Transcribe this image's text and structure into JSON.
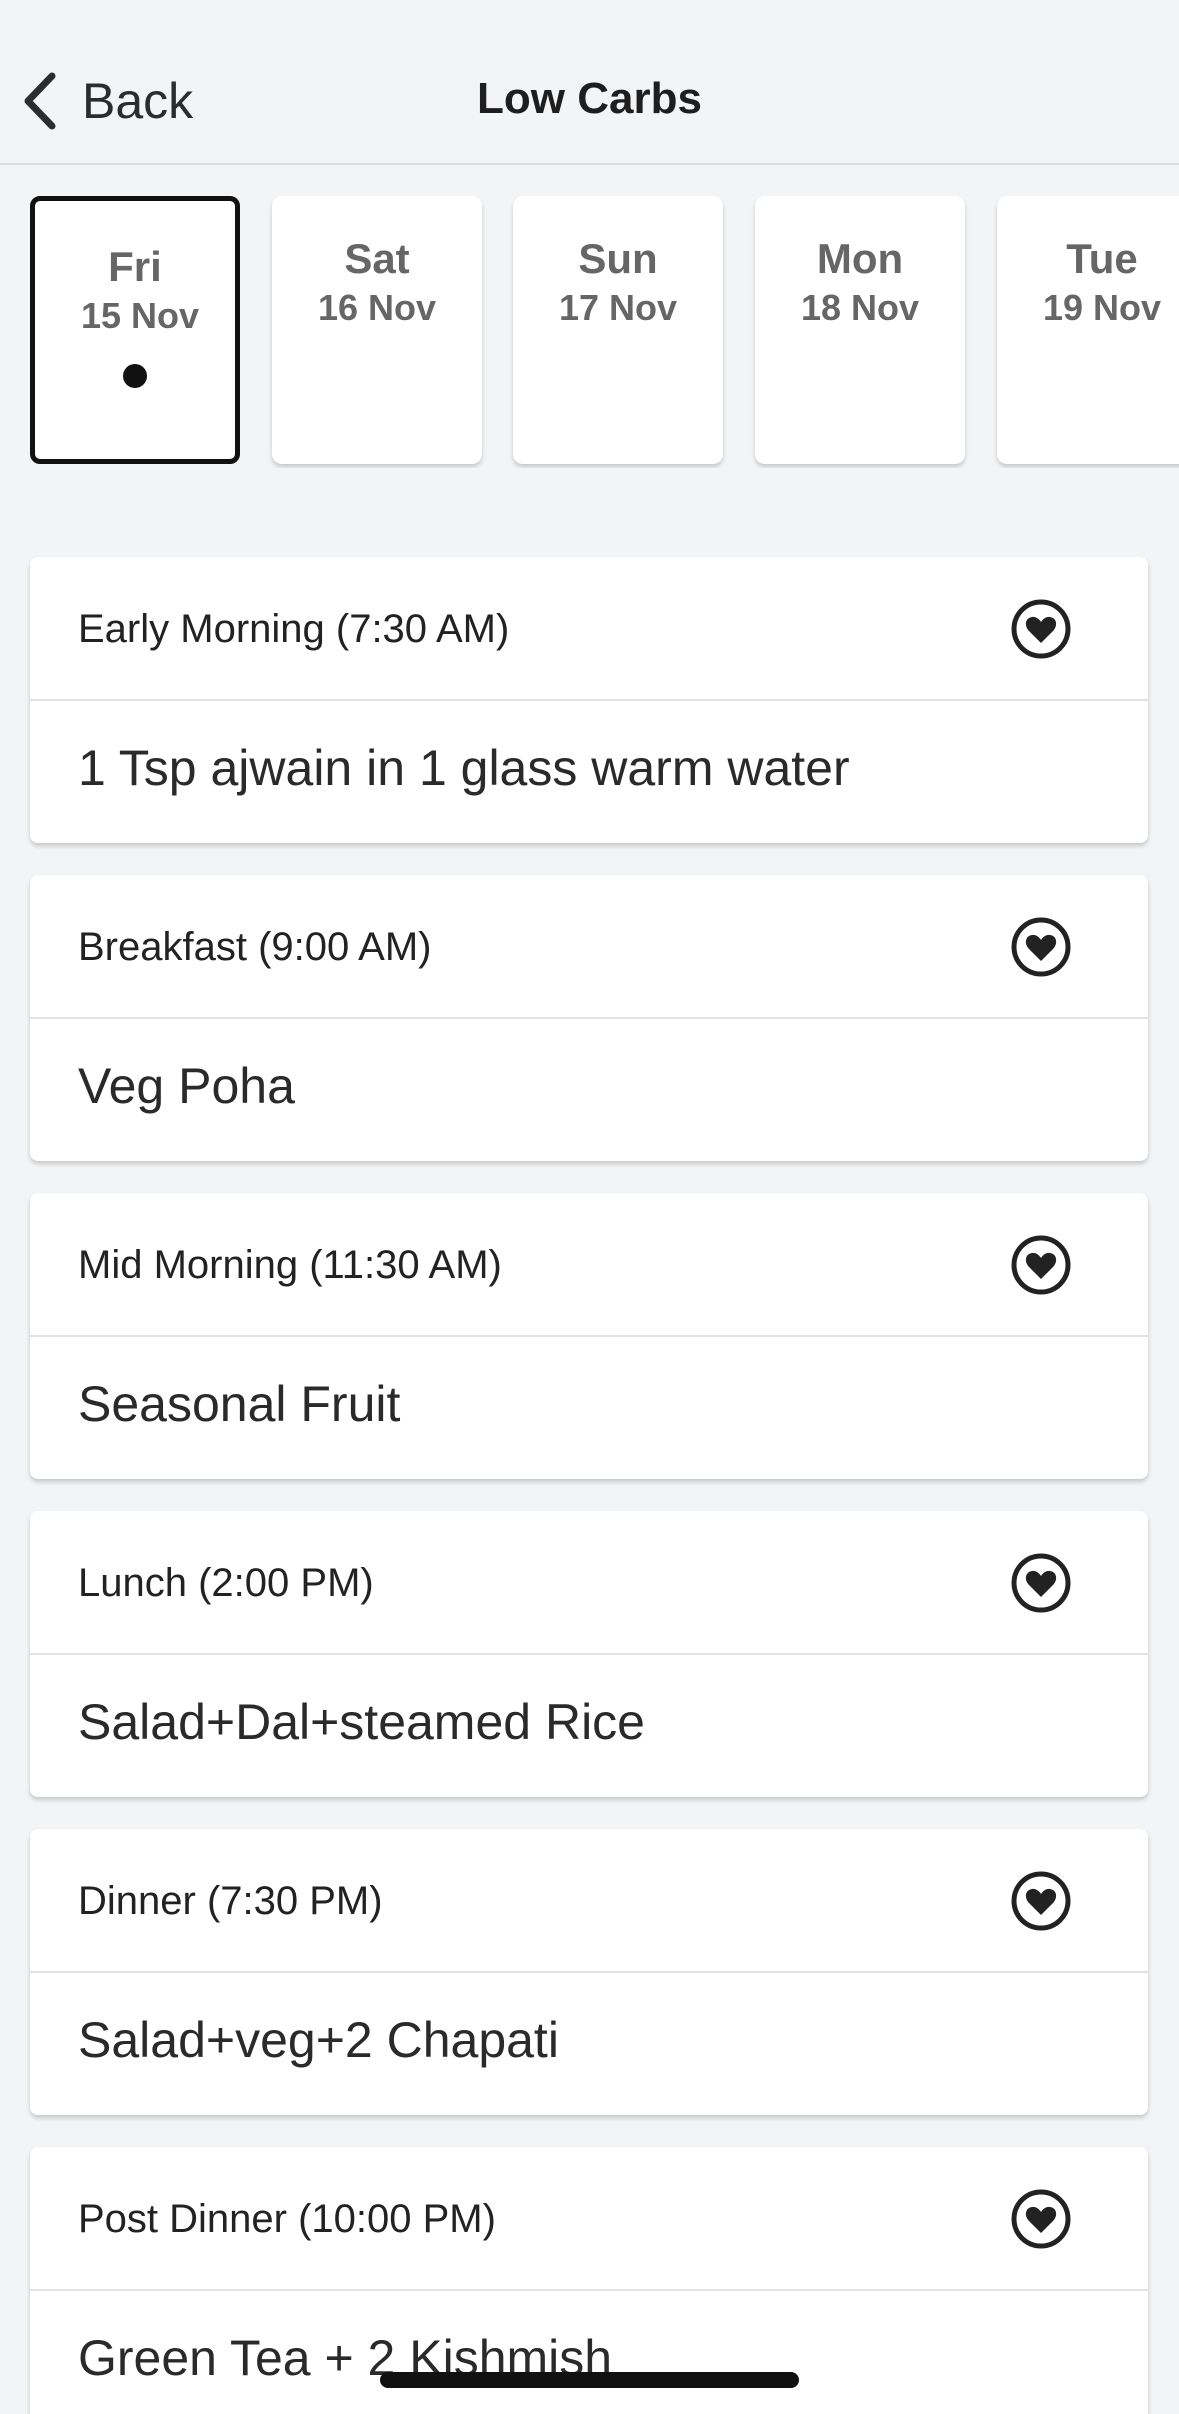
{
  "header": {
    "back_label": "Back",
    "title": "Low Carbs"
  },
  "dates": [
    {
      "day": "Fri",
      "date": "15 Nov",
      "selected": true
    },
    {
      "day": "Sat",
      "date": "16 Nov",
      "selected": false
    },
    {
      "day": "Sun",
      "date": "17 Nov",
      "selected": false
    },
    {
      "day": "Mon",
      "date": "18 Nov",
      "selected": false
    },
    {
      "day": "Tue",
      "date": "19 Nov",
      "selected": false
    }
  ],
  "meals": [
    {
      "label": "Early Morning (7:30 AM)",
      "item": "1 Tsp ajwain in 1 glass warm water"
    },
    {
      "label": "Breakfast (9:00 AM)",
      "item": "Veg Poha"
    },
    {
      "label": "Mid Morning (11:30 AM)",
      "item": "Seasonal Fruit"
    },
    {
      "label": "Lunch (2:00 PM)",
      "item": "Salad+Dal+steamed Rice"
    },
    {
      "label": "Dinner (7:30 PM)",
      "item": "Salad+veg+2 Chapati"
    },
    {
      "label": "Post Dinner (10:00 PM)",
      "item": "Green Tea + 2 Kishmish"
    }
  ],
  "icons": {
    "back": "chevron-left-icon",
    "favorite": "heart-circle-icon"
  },
  "colors": {
    "background": "#f3f4f6",
    "card": "#ffffff",
    "selected_border": "#111111",
    "text": "#2a2a2a",
    "muted_text": "#666666"
  }
}
